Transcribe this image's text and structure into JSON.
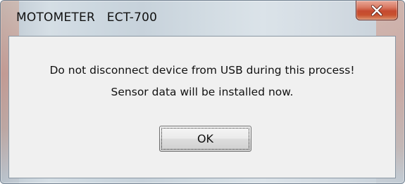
{
  "window": {
    "title": "MOTOMETER   ECT-700"
  },
  "titlebar": {
    "close_icon": "close-icon"
  },
  "dialog": {
    "message_lines": [
      "Do not disconnect device from USB during this process!",
      "Sensor data will be installed now."
    ],
    "ok_label": "OK"
  },
  "colors": {
    "close_button": "#c8512f",
    "content_background": "#f0f0f0"
  }
}
